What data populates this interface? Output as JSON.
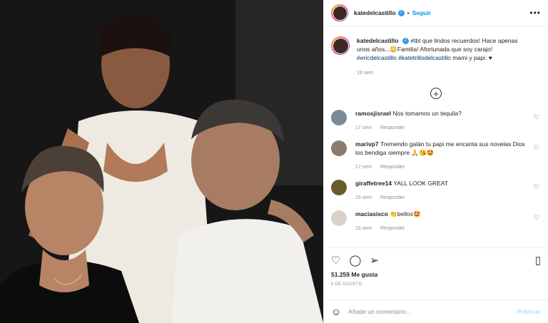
{
  "header": {
    "username": "katedelcastillo",
    "verified_icon": "verified-badge-icon",
    "dot": "•",
    "follow_label": "Seguir",
    "more_icon": "more-options-icon",
    "more_glyph": "•••"
  },
  "caption": {
    "username": "katedelcastillo",
    "text_1": " ",
    "tag_1": "#tbt",
    "text_2": " que lindos recuerdos! Hace apenas unos años...😳Familia! Afortunada que soy carajo! ",
    "tag_2": "#ericdelcastillo",
    "text_3": " ",
    "tag_3": "#katetrillodelcastillo",
    "text_4": " mami y papi. ♥",
    "time": "19 sem"
  },
  "load_more_glyph": "+",
  "comments": [
    {
      "username": "ramosjisrael",
      "text": "Nos tomamos un tequila?",
      "time": "17 sem",
      "reply": "Responder",
      "avatar_color": "#7a8a99"
    },
    {
      "username": "marivp7",
      "text": "Tremendo galán tu papi me encanta sus novelas Dios los bendiga siempre 🙏😘🤩",
      "time": "17 sem",
      "reply": "Responder",
      "avatar_color": "#8b7b6a"
    },
    {
      "username": "giraffetree14",
      "text": "YALL LOOK GREAT",
      "time": "15 sem",
      "reply": "Responder",
      "avatar_color": "#6b5a2e"
    },
    {
      "username": "maciasisco",
      "text": "👏bellos🤩",
      "time": "15 sem",
      "reply": "Responder",
      "avatar_color": "#d8d2c8"
    }
  ],
  "actions": {
    "like_icon": "heart-icon",
    "comment_icon": "comment-icon",
    "share_icon": "share-icon",
    "save_icon": "bookmark-icon",
    "likes_count": "51.259",
    "likes_label": "Me gusta",
    "date": "5 DE AGOSTO"
  },
  "add_comment": {
    "emoji_icon": "emoji-icon",
    "placeholder": "Añade un comentario...",
    "publish_label": "Publicar"
  },
  "colors": {
    "link_blue": "#0095f6",
    "hashtag": "#00376b",
    "muted": "#8e8e8e",
    "publish_disabled": "#b2dffc"
  }
}
